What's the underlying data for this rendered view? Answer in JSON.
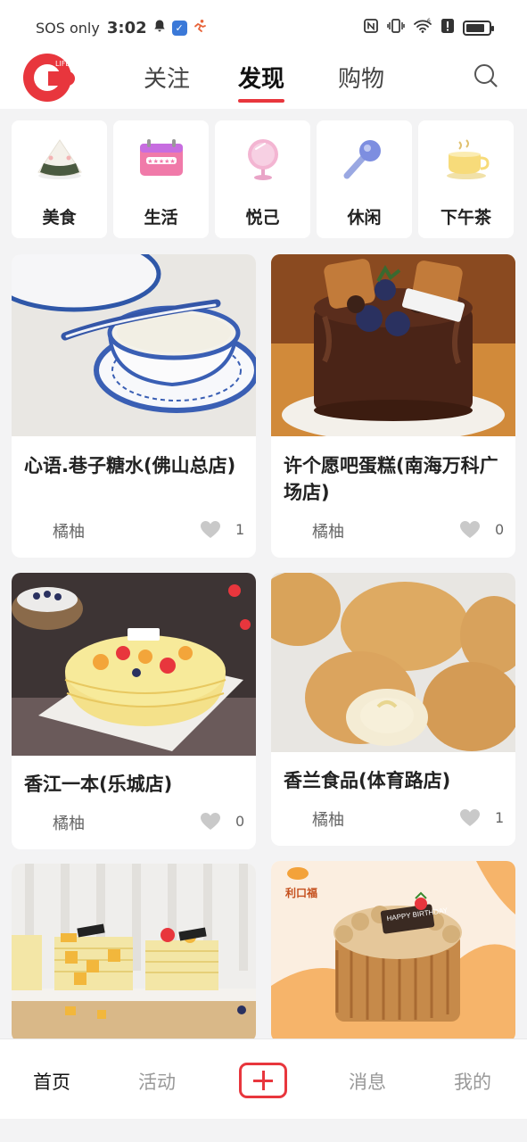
{
  "status_bar": {
    "carrier": "SOS only",
    "time": "3:02",
    "icons": [
      "bell-icon",
      "app-notification-icon",
      "fitness-icon",
      "nfc-icon",
      "vibrate-icon",
      "wifi-icon",
      "alert-icon",
      "battery-icon"
    ],
    "wifi_badge": "6",
    "battery_level": 0.85
  },
  "header": {
    "logo_text": "LIFE",
    "tabs": [
      {
        "label": "关注",
        "active": false
      },
      {
        "label": "发现",
        "active": true
      },
      {
        "label": "购物",
        "active": false
      }
    ],
    "search_icon": "search-icon",
    "accent_color": "#e8363d"
  },
  "categories": [
    {
      "label": "美食",
      "icon": "rice-ball-icon"
    },
    {
      "label": "生活",
      "icon": "calendar-icon"
    },
    {
      "label": "悦己",
      "icon": "mirror-icon"
    },
    {
      "label": "休闲",
      "icon": "microphone-icon"
    },
    {
      "label": "下午茶",
      "icon": "teacup-icon"
    }
  ],
  "feed": [
    {
      "title": "心语.巷子糖水(佛山总店)",
      "author": "橘柚",
      "likes": "1",
      "image": "dessert-bowl-photo"
    },
    {
      "title": "许个愿吧蛋糕(南海万科广场店)",
      "author": "橘柚",
      "likes": "0",
      "image": "chocolate-cake-photo"
    },
    {
      "title": "香江一本(乐城店)",
      "author": "橘柚",
      "likes": "0",
      "image": "mango-crepe-cake-photo"
    },
    {
      "title": "香兰食品(体育路店)",
      "author": "橘柚",
      "likes": "1",
      "image": "cream-puff-photo"
    },
    {
      "title": "",
      "author": "",
      "likes": "",
      "image": "crepe-cake-slices-photo"
    },
    {
      "title": "",
      "author": "",
      "likes": "",
      "image": "birthday-cake-photo",
      "brand_text": "利口福",
      "cake_text": "HAPPY BIRTHDAY"
    }
  ],
  "bottom_nav": [
    {
      "label": "首页",
      "active": true
    },
    {
      "label": "活动",
      "active": false
    },
    {
      "label": "",
      "icon": "add-icon"
    },
    {
      "label": "消息",
      "active": false
    },
    {
      "label": "我的",
      "active": false
    }
  ]
}
